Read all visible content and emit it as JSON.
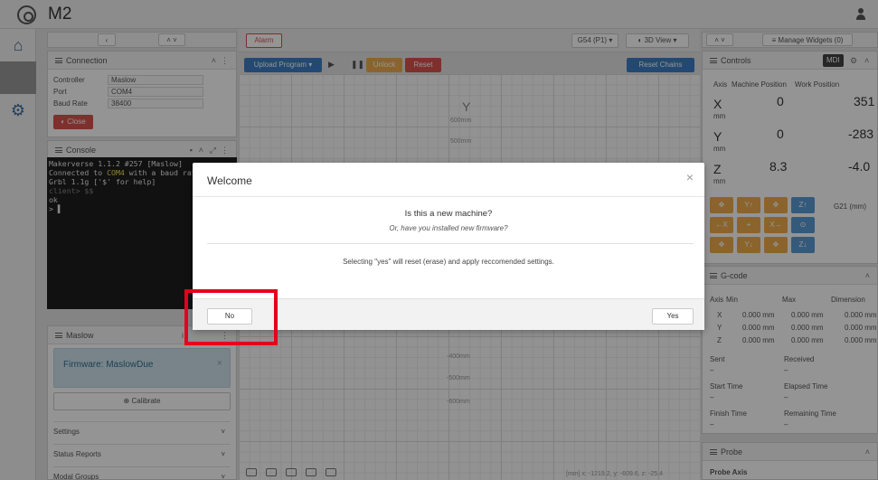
{
  "app": {
    "title": "M2"
  },
  "nav": {
    "icons": [
      "home-icon",
      "connection-view-icon",
      "settings-cogs-icon"
    ]
  },
  "connection": {
    "title": "Connection",
    "fields": [
      {
        "label": "Controller",
        "value": "Maslow"
      },
      {
        "label": "Port",
        "value": "COM4"
      },
      {
        "label": "Baud Rate",
        "value": "38400"
      }
    ],
    "close_label": "Close"
  },
  "console": {
    "title": "Console",
    "lines": {
      "l1": "Makerverse 1.1.2 #257 [Maslow]",
      "l2a": "Connected to ",
      "l2b": "COM4",
      "l2c": " with a baud rat",
      "l3": "Grbl 1.1g ['$' for help]",
      "l4": "client> $$",
      "l5": "ok",
      "l6": "> ▌"
    }
  },
  "maslow": {
    "title": "Maslow",
    "firmware": "Firmware: MaslowDue",
    "calibrate_label": "Calibrate",
    "sections": [
      "Settings",
      "Status Reports",
      "Modal Groups"
    ]
  },
  "toolbar": {
    "alarm_label": "Alarm",
    "upload_label": "Upload Program",
    "unlock_label": "Unlock",
    "reset_label": "Reset",
    "reset_chains_label": "Reset Chains",
    "wcs_label": "G54 (P1)",
    "view_label": "3D View"
  },
  "canvas": {
    "y_label": "Y",
    "ticks": [
      "600mm",
      "500mm",
      "-400mm",
      "-500mm",
      "-600mm"
    ],
    "status": "[mm] x: -1219.2, y: -609.6, z: -25.4"
  },
  "widgets": {
    "manage_label": "Manage Widgets (0)"
  },
  "controls": {
    "title": "Controls",
    "mdi_label": "MDI",
    "col_axis": "Axis",
    "col_machine": "Machine Position",
    "col_work": "Work Position",
    "unit": "mm",
    "axes": [
      {
        "name": "X",
        "machine": "0",
        "work": "351"
      },
      {
        "name": "Y",
        "machine": "0",
        "work": "-283"
      },
      {
        "name": "Z",
        "machine": "8.3",
        "work": "-4.0"
      }
    ],
    "units_select": "G21 (mm)"
  },
  "gcode": {
    "title": "G-code",
    "headers": [
      "Axis",
      "Min",
      "Max",
      "Dimension"
    ],
    "rows": [
      [
        "X",
        "0.000 mm",
        "0.000 mm",
        "0.000 mm"
      ],
      [
        "Y",
        "0.000 mm",
        "0.000 mm",
        "0.000 mm"
      ],
      [
        "Z",
        "0.000 mm",
        "0.000 mm",
        "0.000 mm"
      ]
    ],
    "stats": [
      "Sent",
      "Received",
      "Start Time",
      "Elapsed Time",
      "Finish Time",
      "Remaining Time"
    ],
    "dash": "–"
  },
  "probe": {
    "title": "Probe",
    "axis_label": "Probe Axis"
  },
  "modal": {
    "title": "Welcome",
    "question": "Is this a new machine?",
    "subtitle": "Or, have you installed new firmware?",
    "note": "Selecting \"yes\" will reset (erase) and apply reccomended settings.",
    "no_label": "No",
    "yes_label": "Yes",
    "close_glyph": "×"
  },
  "colors": {
    "danger": "#d9534f",
    "primary": "#3d7fc4",
    "warning": "#f0ad4e",
    "highlight": "#e5001c"
  }
}
